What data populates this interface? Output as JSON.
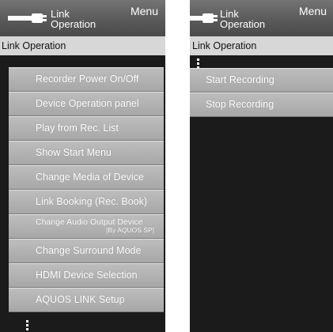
{
  "left_panel": {
    "header": {
      "title_line1": "Link",
      "title_line2": "Operation",
      "menu": "Menu"
    },
    "breadcrumb": "Link Operation",
    "items": [
      {
        "label": "Recorder Power On/Off"
      },
      {
        "label": "Device Operation panel"
      },
      {
        "label": "Play from Rec. List"
      },
      {
        "label": "Show Start Menu"
      },
      {
        "label": "Change Media of Device"
      },
      {
        "label": "Link Booking (Rec. Book)"
      },
      {
        "label": "Change Audio Output Device",
        "sub": "[By AQUOS SP]"
      },
      {
        "label": "Change Surround Mode"
      },
      {
        "label": "HDMI Device Selection"
      },
      {
        "label": "AQUOS LINK Setup"
      }
    ]
  },
  "right_panel": {
    "header": {
      "title_line1": "Link",
      "title_line2": "Operation",
      "menu": "Menu"
    },
    "breadcrumb": "Link Operation",
    "items": [
      {
        "label": "Start Recording"
      },
      {
        "label": "Stop Recording"
      }
    ]
  }
}
